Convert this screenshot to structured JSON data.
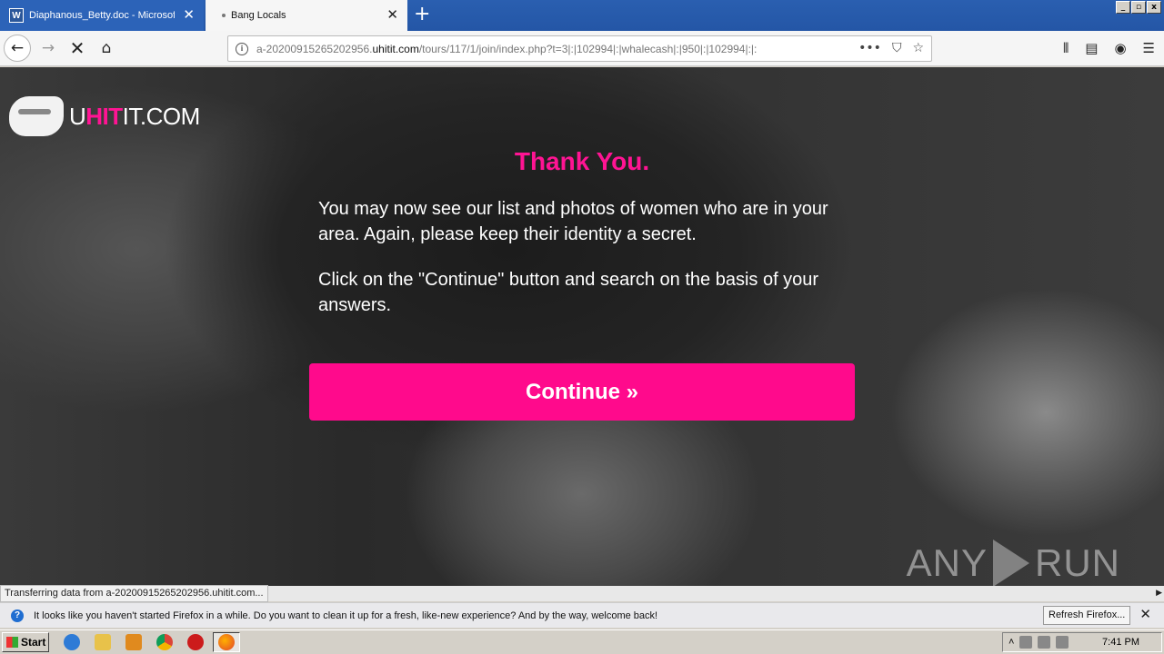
{
  "tabs": [
    {
      "label": "Diaphanous_Betty.doc - Microsoft Word",
      "icon": "word-icon"
    },
    {
      "label": "Bang Locals",
      "icon": "loading-dot"
    }
  ],
  "nav": {
    "url_prefix": "a-20200915265202956.",
    "url_domain": "uhitit.com",
    "url_path": "/tours/117/1/join/index.php?t=3|:|102994|:|whalecash|:|950|:|102994|:|:",
    "url_actions": [
      "•••",
      "⛉",
      "☆"
    ]
  },
  "page": {
    "logo_text_u": "U",
    "logo_text_hit": "HIT",
    "logo_text_rest": "IT.COM",
    "heading": "Thank You.",
    "paragraph1": "You may now see our list and photos of women who are in your area. Again, please keep their identity a secret.",
    "paragraph2": "Click on the \"Continue\" button and search on the basis of your answers.",
    "continue_label": "Continue »",
    "accent_color": "#ff0a8c"
  },
  "watermark": {
    "left": "ANY",
    "right": "RUN"
  },
  "status_text": "Transferring data from a-20200915265202956.uhitit.com...",
  "notification": {
    "message": "It looks like you haven't started Firefox in a while. Do you want to clean it up for a fresh, like-new experience? And by the way, welcome back!",
    "button": "Refresh Firefox..."
  },
  "taskbar": {
    "start_label": "Start",
    "clock": "7:41 PM"
  }
}
